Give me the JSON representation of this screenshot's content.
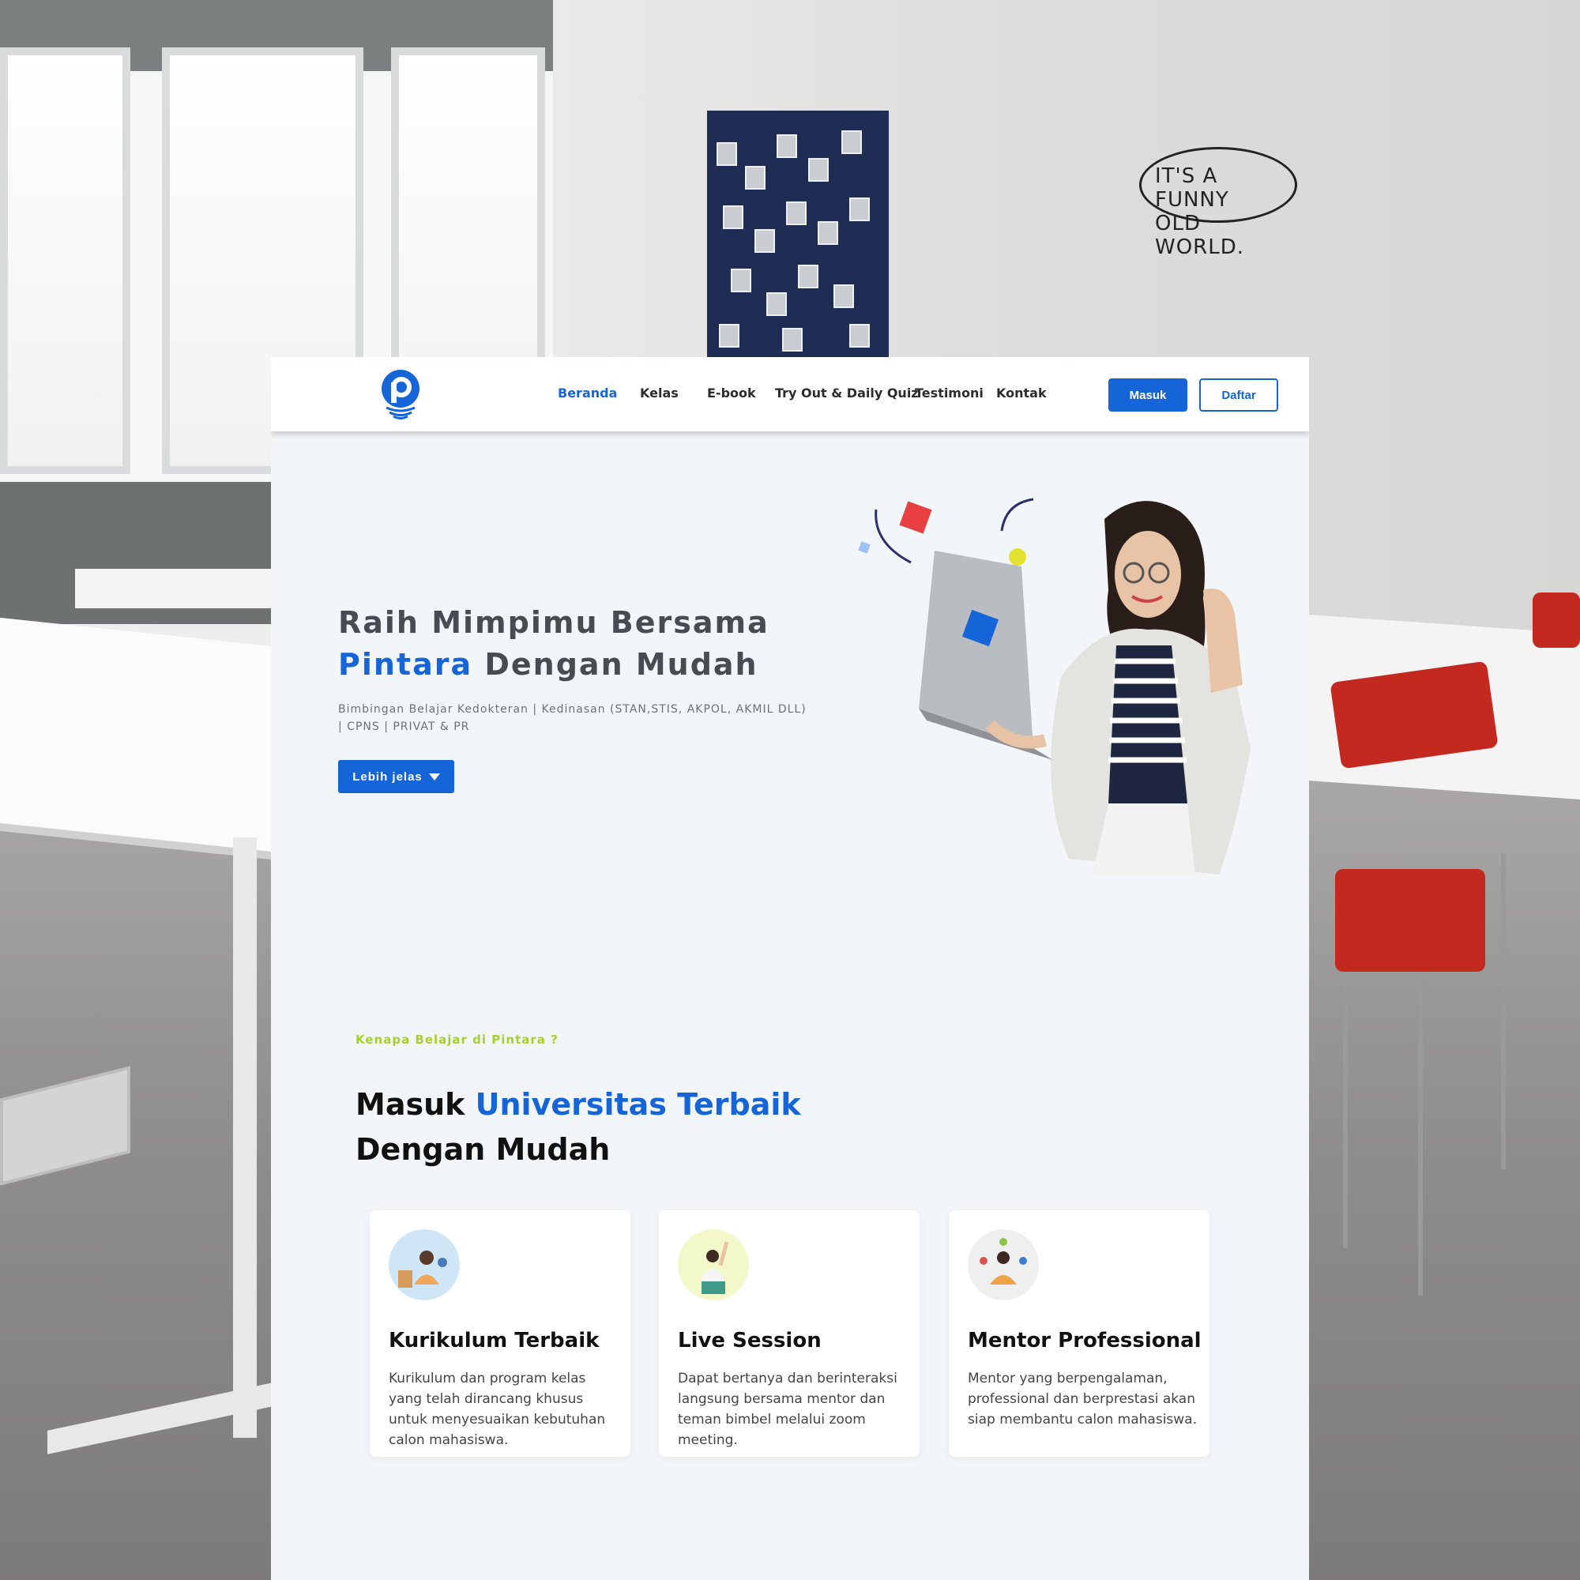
{
  "background": {
    "speech_bubble": [
      "IT'S A FUNNY",
      "OLD WORLD."
    ]
  },
  "navbar": {
    "items": [
      {
        "label": "Beranda",
        "active": true
      },
      {
        "label": "Kelas",
        "active": false
      },
      {
        "label": "E-book",
        "active": false
      },
      {
        "label": "Try Out & Daily Quiz",
        "active": false
      },
      {
        "label": "Testimoni",
        "active": false
      },
      {
        "label": "Kontak",
        "active": false
      }
    ],
    "login_label": "Masuk",
    "register_label": "Daftar"
  },
  "hero": {
    "title_line1": "Raih Mimpimu Bersama",
    "title_accent": "Pintara",
    "title_line2_rest": " Dengan Mudah",
    "subtitle": "Bimbingan Belajar Kedokteran | Kedinasan (STAN,STIS, AKPOL, AKMIL DLL) | CPNS | PRIVAT & PR",
    "cta_label": "Lebih jelas"
  },
  "why": {
    "label": "Kenapa Belajar di Pintara ?",
    "title_prefix": "Masuk ",
    "title_accent": "Universitas Terbaik",
    "title_line2": "Dengan Mudah",
    "cards": [
      {
        "title": "Kurikulum Terbaik",
        "desc": "Kurikulum dan program kelas yang telah dirancang khusus untuk menyesuaikan kebutuhan calon mahasiswa.",
        "icon": "student-studying-avatar"
      },
      {
        "title": "Live Session",
        "desc": "Dapat bertanya dan berinteraksi langsung bersama mentor dan teman bimbel melalui zoom meeting.",
        "icon": "raised-hand-student-avatar"
      },
      {
        "title": "Mentor Professional",
        "desc": "Mentor yang berpengalaman, professional dan berprestasi akan siap membantu calon mahasiswa.",
        "icon": "meditating-mentor-avatar"
      }
    ]
  },
  "colors": {
    "brand_blue": "#1565d8",
    "accent_green": "#a8cf2a",
    "page_bg": "#f3f6f9",
    "text_dark": "#474b52"
  }
}
